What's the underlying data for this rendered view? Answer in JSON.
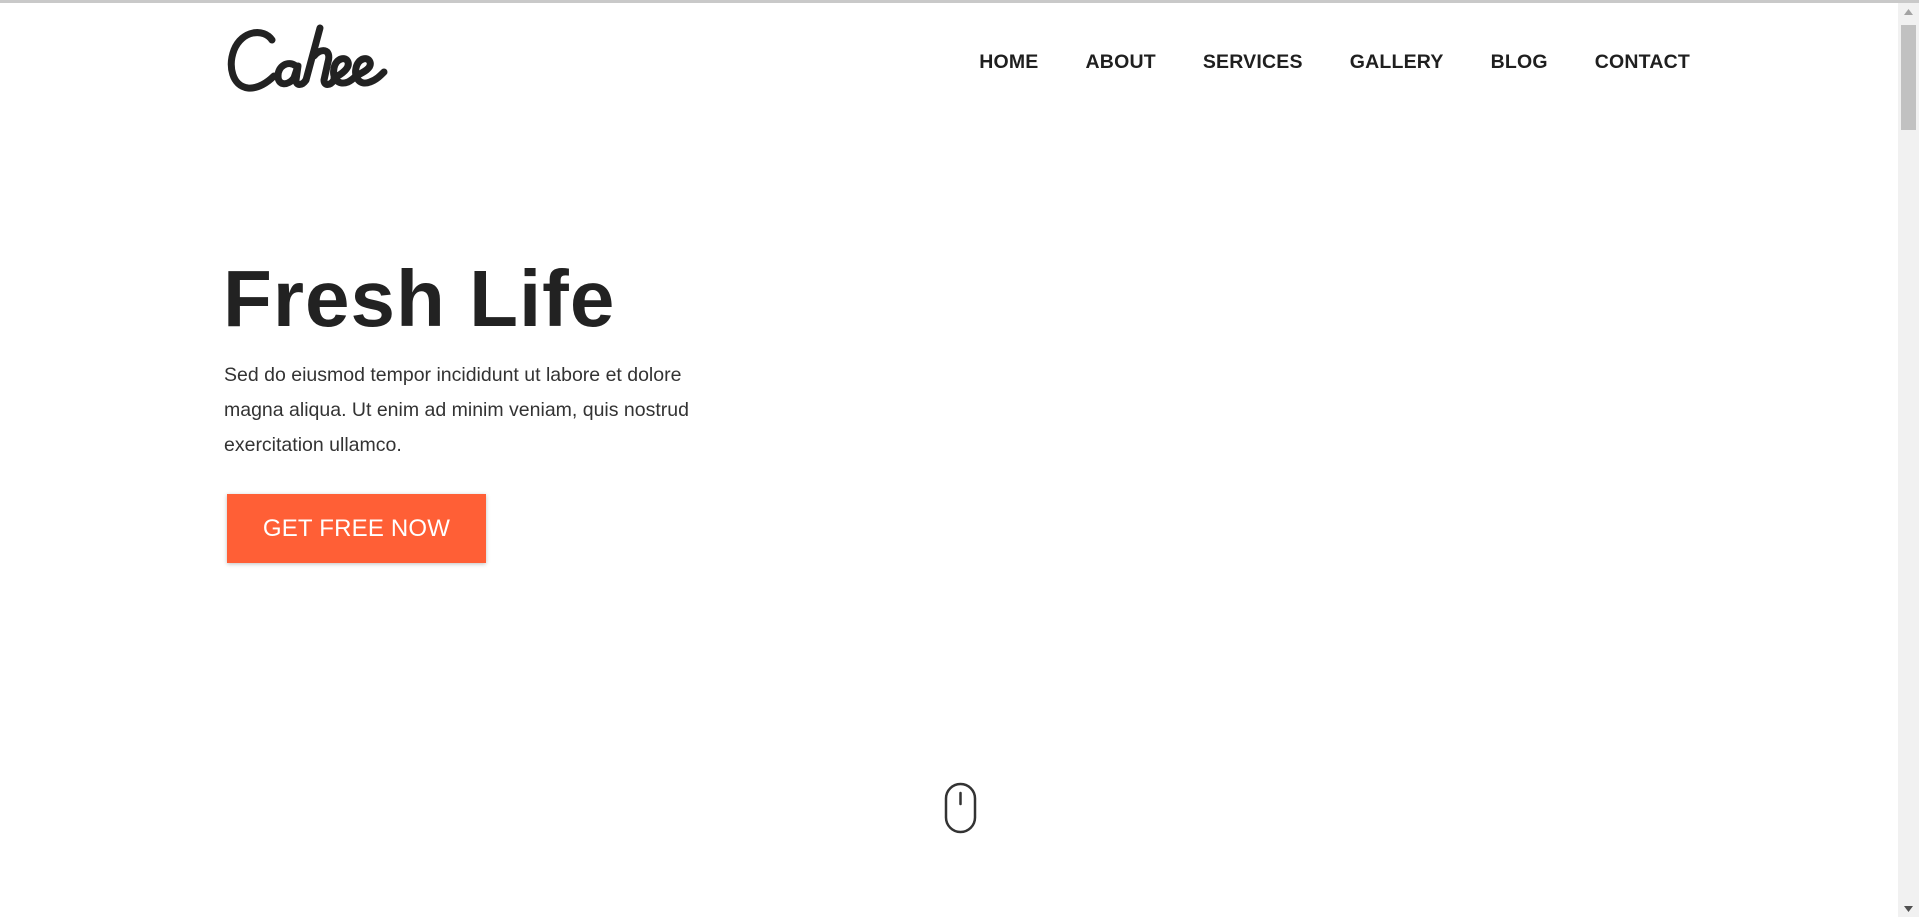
{
  "header": {
    "logo_text": "Cahee",
    "nav": [
      {
        "label": "HOME"
      },
      {
        "label": "ABOUT"
      },
      {
        "label": "SERVICES"
      },
      {
        "label": "GALLERY"
      },
      {
        "label": "BLOG"
      },
      {
        "label": "CONTACT"
      }
    ]
  },
  "hero": {
    "title": "Fresh Life",
    "text": "Sed do eiusmod tempor incididunt ut labore et dolore magna aliqua. Ut enim ad minim veniam, quis nostrud exercitation ullamco.",
    "cta_label": "GET FREE NOW"
  },
  "scroll_indicator": {
    "icon": "mouse-icon"
  },
  "colors": {
    "accent": "#ff5f36",
    "text": "#222222",
    "background": "#ffffff"
  }
}
